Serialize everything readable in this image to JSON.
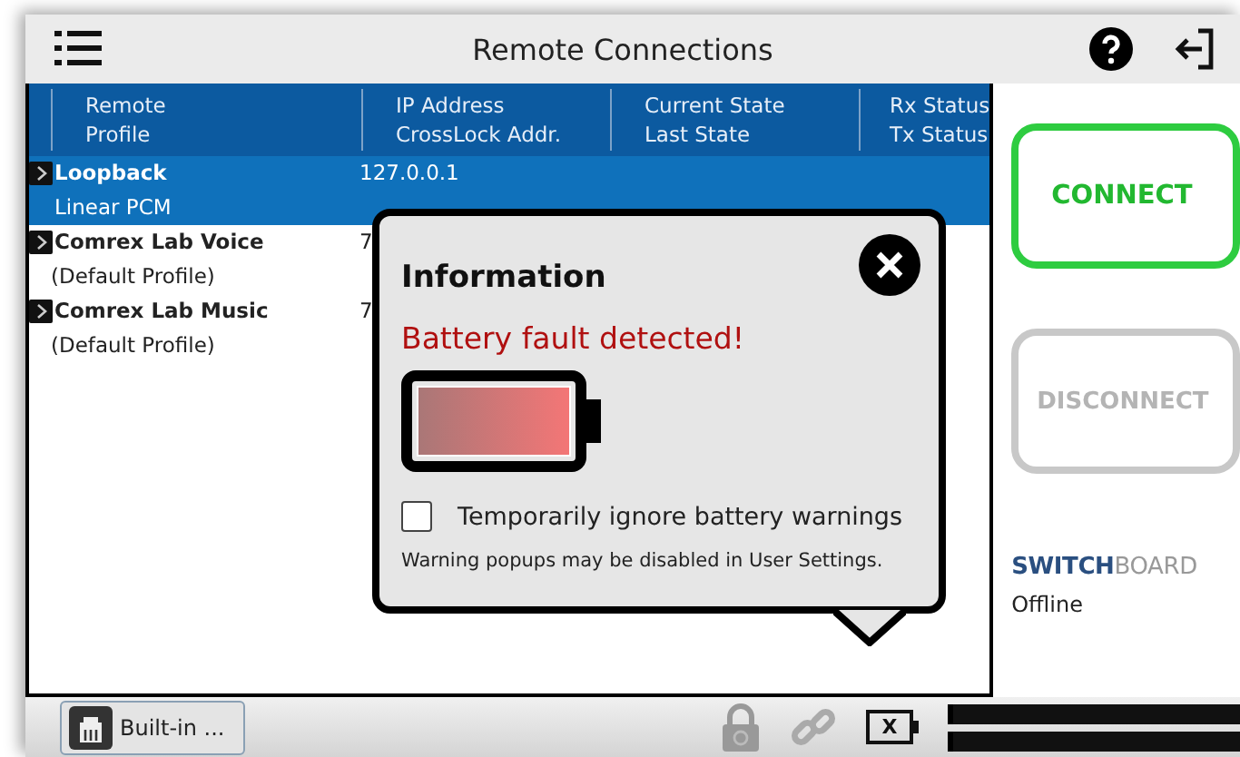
{
  "window": {
    "title": "Remote Connections"
  },
  "table": {
    "columns": [
      {
        "line1": "Remote",
        "line2": "Profile"
      },
      {
        "line1": "IP Address",
        "line2": "CrossLock Addr."
      },
      {
        "line1": "Current State",
        "line2": "Last State"
      },
      {
        "line1": "Rx Status",
        "line2": "Tx Status"
      }
    ],
    "rows": [
      {
        "name": "Loopback",
        "profile": "Linear PCM",
        "ip": "127.0.0.1",
        "selected": true
      },
      {
        "name": "Comrex Lab Voice",
        "profile": "(Default Profile)",
        "ip": "7",
        "selected": false
      },
      {
        "name": "Comrex Lab Music",
        "profile": "(Default Profile)",
        "ip": "7",
        "selected": false
      }
    ]
  },
  "dialog": {
    "title": "Information",
    "message": "Battery fault detected!",
    "checkbox": {
      "label": "Temporarily ignore battery warnings",
      "checked": false
    },
    "note": "Warning popups may be disabled in User Settings."
  },
  "side_panel": {
    "buttons": [
      {
        "label": "CONNECT",
        "disabled": false
      },
      {
        "label": "DISCONNECT",
        "disabled": true
      }
    ],
    "logo": {
      "primary": "SWITCH",
      "secondary": "BOARD"
    },
    "status": "Offline"
  },
  "status_bar": {
    "audio_button": "Built-in ...",
    "battery_label": "X"
  }
}
